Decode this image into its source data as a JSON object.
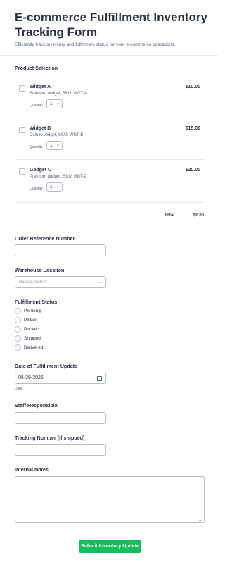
{
  "form": {
    "title_line1": "E-commerce Fulfillment Inventory",
    "title_line2": "Tracking Form",
    "subtitle": "Efficiently track inventory and fulfillment status for your e-commerce operations."
  },
  "product_section": {
    "label": "Product Selection",
    "products": [
      {
        "name": "Widget A",
        "description": "Standard widget, SKU: WGT-A",
        "price": "$10.00",
        "quantity_label": "Quantity",
        "quantity": "1",
        "checked": false
      },
      {
        "name": "Widget B",
        "description": "Deluxe widget, SKU: WGT-B",
        "price": "$15.00",
        "quantity_label": "Quantity",
        "quantity": "1",
        "checked": false
      },
      {
        "name": "Gadget C",
        "description": "Premium gadget, SKU: GDT-C",
        "price": "$20.00",
        "quantity_label": "Quantity",
        "quantity": "1",
        "checked": false
      }
    ],
    "total_label": "Total",
    "total_value": "$0.00"
  },
  "order_reference": {
    "label": "Order Reference Number",
    "value": ""
  },
  "warehouse": {
    "label": "Warehouse Location",
    "placeholder": "Please Select"
  },
  "fulfillment_status": {
    "label": "Fulfillment Status",
    "options": [
      "Pending",
      "Picked",
      "Packed",
      "Shipped",
      "Delivered"
    ],
    "selected": null
  },
  "fulfillment_date": {
    "label": "Date of Fulfillment Update",
    "value": "05-29-2026",
    "sublabel": "Date"
  },
  "staff": {
    "label": "Staff Responsible",
    "value": ""
  },
  "tracking": {
    "label": "Tracking Number (if shipped)",
    "value": ""
  },
  "notes": {
    "label": "Internal Notes",
    "value": ""
  },
  "submit": {
    "label": "Submit Inventory Update"
  },
  "colors": {
    "accent": "#18bd5b",
    "text": "#2c3345",
    "muted": "#57647e",
    "border": "#b8bdc9"
  },
  "icons": {
    "checkbox": "checkbox-icon",
    "dropdown": "chevron-down-icon",
    "calendar": "calendar-icon",
    "radio": "radio-icon"
  }
}
